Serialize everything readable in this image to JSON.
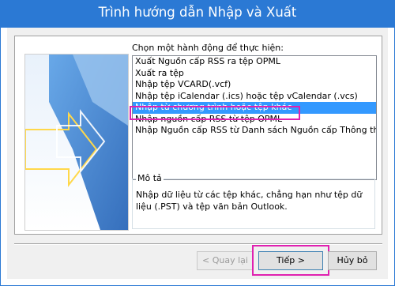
{
  "window": {
    "title": "Trình hướng dẫn Nhập và Xuất",
    "title_bar_color": "#2b79d4"
  },
  "action_prompt": "Chọn một hành động để thực hiện:",
  "actions": [
    {
      "label": "Xuất Nguồn cấp RSS ra tệp OPML",
      "selected": false
    },
    {
      "label": "Xuất ra tệp",
      "selected": false
    },
    {
      "label": "Nhập tệp VCARD(.vcf)",
      "selected": false
    },
    {
      "label": "Nhập tệp iCalendar (.ics) hoặc tệp vCalendar (.vcs)",
      "selected": false
    },
    {
      "label": "Nhập từ chương trình hoặc tệp khác",
      "selected": true
    },
    {
      "label": "Nhập nguồn cấp RSS từ tệp OPML",
      "selected": false
    },
    {
      "label": "Nhập Nguồn cấp RSS từ Danh sách Nguồn cấp Thông thường",
      "selected": false
    }
  ],
  "description": {
    "legend": "Mô tả",
    "text": "Nhập dữ liệu từ các tệp khác, chẳng hạn như tệp dữ liệu (.PST) và tệp văn bản Outlook."
  },
  "buttons": {
    "back": "< Quay lại",
    "next": "Tiếp >",
    "cancel": "Hủy bỏ"
  },
  "colors": {
    "selection": "#3399ff",
    "highlight_outline": "#e020b0"
  }
}
